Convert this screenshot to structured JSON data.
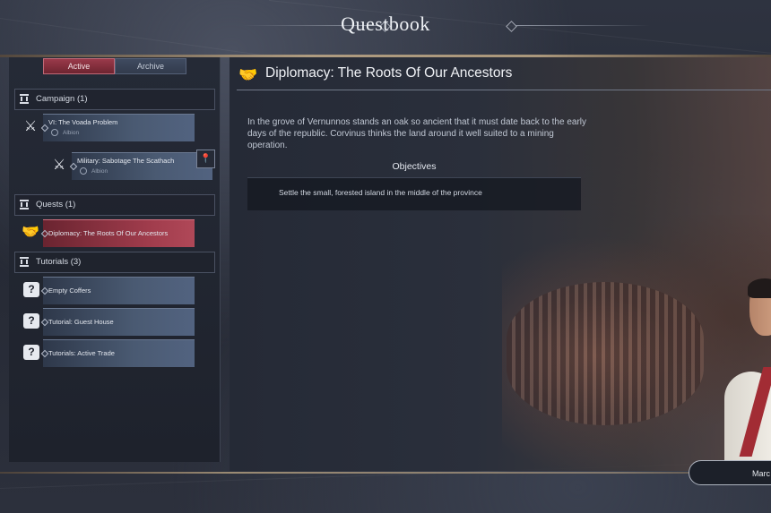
{
  "header": {
    "title": "Questbook"
  },
  "tabs": [
    {
      "label": "Active",
      "selected": true
    },
    {
      "label": "Archive",
      "selected": false
    }
  ],
  "sections": {
    "campaign": {
      "label": "Campaign (1)"
    },
    "quests": {
      "label": "Quests (1)"
    },
    "tutorials": {
      "label": "Tutorials (3)"
    }
  },
  "campaign_items": [
    {
      "title": "VI: The Voada Problem",
      "region": "Albion",
      "icon": "crossed-swords-icon"
    },
    {
      "title": "Military: Sabotage The Scathach",
      "region": "Albion",
      "icon": "crossed-swords-icon"
    }
  ],
  "quest_items": [
    {
      "title": "Diplomacy: The Roots Of Our Ancestors",
      "icon": "handshake-icon",
      "selected": true
    }
  ],
  "tutorial_items": [
    {
      "title": "Empty Coffers",
      "icon": "question-icon"
    },
    {
      "title": "Tutorial: Guest House",
      "icon": "question-icon"
    },
    {
      "title": "Tutorials: Active Trade",
      "icon": "question-icon"
    }
  ],
  "detail": {
    "title": "Diplomacy: The Roots Of Our Ancestors",
    "description": "In the grove of Vernunnos stands an oak so ancient that it must date back to the early days of the republic. Corvinus thinks the land around it well suited to a mining operation.",
    "objectives_heading": "Objectives",
    "objectives": [
      "Settle the small, forested island in the middle of the province"
    ]
  },
  "footer": {
    "date_label": "Marc"
  },
  "colors": {
    "accent_red": "#9a3a4a",
    "gold_rule": "#c9b08a",
    "panel": "#252a36"
  }
}
